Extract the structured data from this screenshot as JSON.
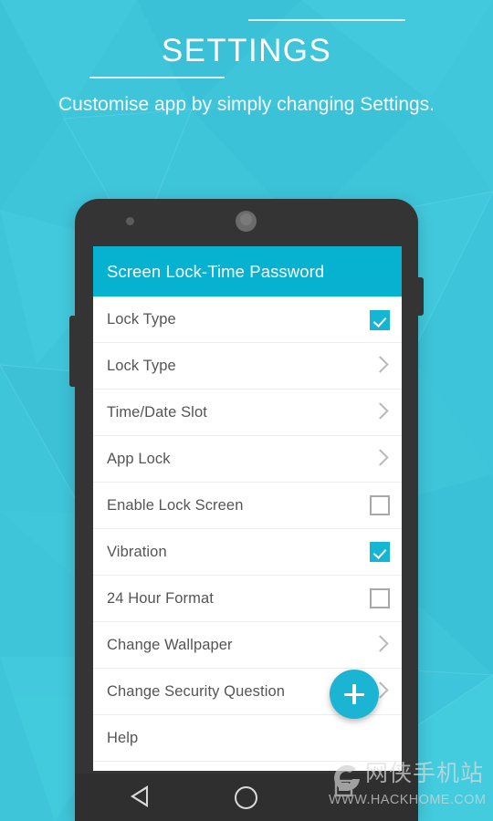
{
  "promo": {
    "title": "SETTINGS",
    "subtitle": "Customise app by simply changing Settings.",
    "divider_top": "hairline-rule",
    "divider_bottom": "hairline-rule"
  },
  "colors": {
    "background_teal": "#3fc5da",
    "appbar_teal": "#07b2d0",
    "accent_teal": "#15b6d3",
    "fab_teal": "#1bb4d2",
    "phone_body": "#343434",
    "navbar": "#2f2f2f",
    "screen_white": "#ffffff",
    "row_label": "#555555",
    "chevron_gray": "#b9b9b9",
    "checkbox_gray": "#a8a8a8"
  },
  "phone": {
    "camera": "camera-dot",
    "speaker": "earpiece-speaker",
    "left_button": "volume-button",
    "right_button": "power-button"
  },
  "app": {
    "appbar": {
      "title": "Screen Lock-Time Password"
    },
    "rows": [
      {
        "label": "Lock Type",
        "control": "checkbox",
        "checked": true
      },
      {
        "label": "Lock Type",
        "control": "chevron",
        "checked": false
      },
      {
        "label": "Time/Date Slot",
        "control": "chevron",
        "checked": false
      },
      {
        "label": "App Lock",
        "control": "chevron",
        "checked": false
      },
      {
        "label": "Enable Lock Screen",
        "control": "checkbox",
        "checked": false
      },
      {
        "label": "Vibration",
        "control": "checkbox",
        "checked": true
      },
      {
        "label": "24 Hour Format",
        "control": "checkbox",
        "checked": false
      },
      {
        "label": "Change Wallpaper",
        "control": "chevron",
        "checked": false
      },
      {
        "label": "Change Security Question",
        "control": "chevron",
        "checked": false
      },
      {
        "label": "Help",
        "control": "none",
        "checked": false
      }
    ],
    "fab": {
      "icon": "plus-icon",
      "label": "+"
    }
  },
  "navbar": {
    "back": "back-triangle-icon",
    "home": "home-circle-icon"
  },
  "watermark": {
    "logo": "hackhome-logo-icon",
    "site_name_cn": "网侠手机站",
    "url": "WWW.HACKHOME.COM"
  }
}
